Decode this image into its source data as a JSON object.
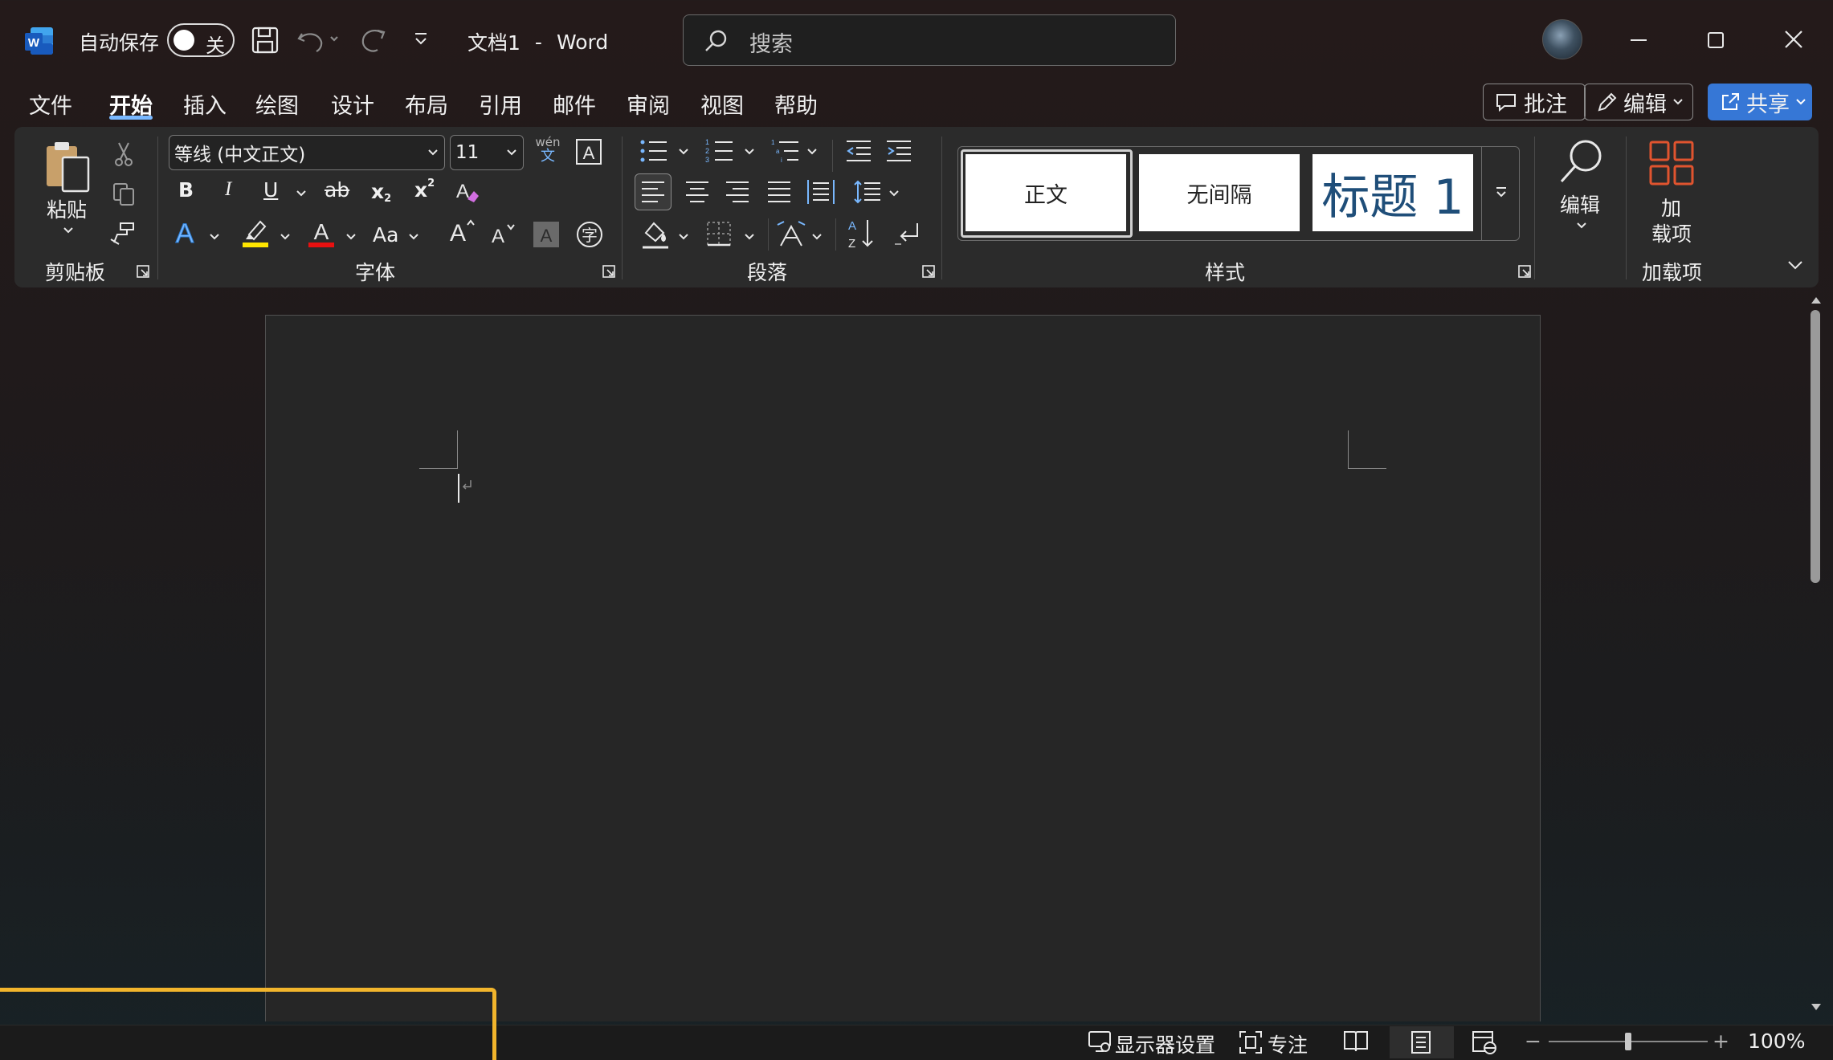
{
  "titlebar": {
    "autosave_label": "自动保存",
    "autosave_state": "关",
    "document_title": "文档1",
    "title_separator": "-",
    "app_name": "Word"
  },
  "search": {
    "placeholder": "搜索"
  },
  "tabs": [
    {
      "label": "文件"
    },
    {
      "label": "开始"
    },
    {
      "label": "插入"
    },
    {
      "label": "绘图"
    },
    {
      "label": "设计"
    },
    {
      "label": "布局"
    },
    {
      "label": "引用"
    },
    {
      "label": "邮件"
    },
    {
      "label": "审阅"
    },
    {
      "label": "视图"
    },
    {
      "label": "帮助"
    }
  ],
  "active_tab": "开始",
  "top_buttons": {
    "comments": "批注",
    "editing": "编辑",
    "share": "共享"
  },
  "ribbon": {
    "clipboard": {
      "paste": "粘贴",
      "group": "剪贴板"
    },
    "font": {
      "name": "等线 (中文正文)",
      "size": "11",
      "phonetic_top": "wén",
      "phonetic_bottom": "文",
      "bold": "B",
      "italic": "I",
      "underline": "U",
      "strike": "ab",
      "sub": "x",
      "sub_mark": "2",
      "sup": "x",
      "sup_mark": "2",
      "change_case": "Aa",
      "char_shade": "A",
      "enclose": "字",
      "group": "字体"
    },
    "paragraph": {
      "group": "段落"
    },
    "styles": {
      "normal": "正文",
      "no_spacing": "无间隔",
      "heading1": "标题 1",
      "group": "样式"
    },
    "editing": {
      "label": "编辑"
    },
    "addins": {
      "label_line1": "加",
      "label_line2": "载项",
      "group": "加载项"
    }
  },
  "statusbar": {
    "display_settings": "显示器设置",
    "focus": "专注",
    "zoom_minus": "−",
    "zoom_plus": "+",
    "zoom_level": "100%",
    "zoom_fraction": 0.5
  },
  "colors": {
    "accent": "#79b8ff",
    "share_button": "#3677d6",
    "highlight": "#f2b52c",
    "addins_icon": "#e0542f",
    "font_color_bar": "#e81010",
    "highlighter_bar": "#ffe600"
  }
}
